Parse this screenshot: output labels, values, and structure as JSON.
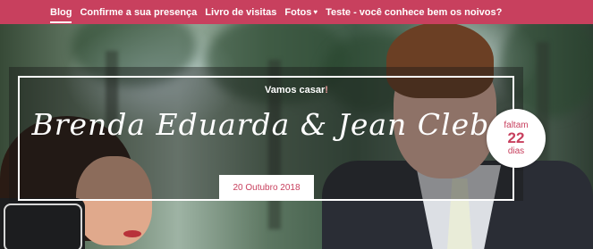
{
  "nav": {
    "items": [
      {
        "label": "Blog",
        "active": true
      },
      {
        "label": "Confirme a sua presença",
        "active": false
      },
      {
        "label": "Livro de visitas",
        "active": false
      },
      {
        "label": "Fotos",
        "active": false,
        "icon": "heart-icon"
      },
      {
        "label": "Teste - você conhece bem os noivos?",
        "active": false
      }
    ],
    "heart_glyph": "♥",
    "color": "#c8405e"
  },
  "hero": {
    "eyebrow": "Vamos casar",
    "eyebrow_exclaim": "!",
    "names": "Brenda Eduarda & Jean Cleber",
    "date": "20 Outubro 2018"
  },
  "countdown": {
    "label_top": "faltam",
    "days": "22",
    "label_bottom": "dias"
  },
  "colors": {
    "accent": "#c8405e",
    "text_light": "#ffffff"
  }
}
